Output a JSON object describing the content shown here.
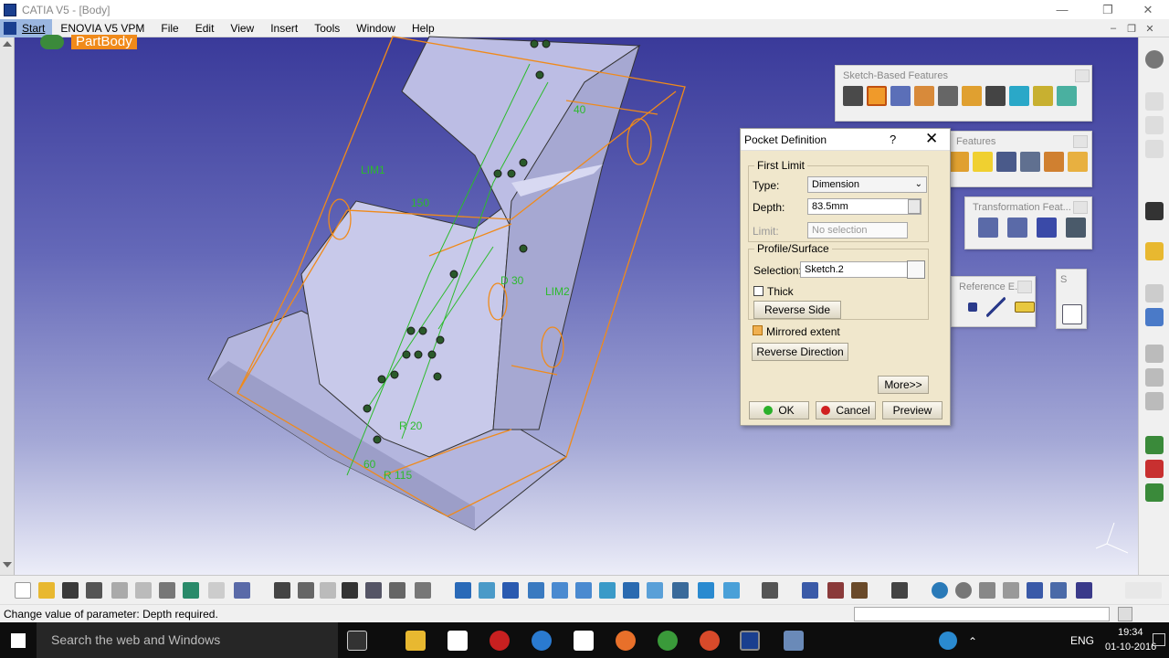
{
  "window": {
    "title": "CATIA V5 - [Body]"
  },
  "menu": {
    "items": [
      "Start",
      "ENOVIA V5 VPM",
      "File",
      "Edit",
      "View",
      "Insert",
      "Tools",
      "Window",
      "Help"
    ]
  },
  "tree": {
    "root": "PartBody"
  },
  "model": {
    "labels": [
      "LIM1",
      "LIM2",
      "150",
      "D 30",
      "40",
      "R 20",
      "R 115",
      "60"
    ]
  },
  "toolbars": {
    "sketch_based": {
      "title": "Sketch-Based Features"
    },
    "features2": {
      "title": "Features"
    },
    "transformation": {
      "title": "Transformation Feat..."
    },
    "reference": {
      "title": "Reference E..."
    },
    "sketcher": {
      "title": "S"
    }
  },
  "dialog": {
    "title": "Pocket Definition",
    "help": "?",
    "close": "✕",
    "first_limit": {
      "legend": "First Limit",
      "type_label": "Type:",
      "type_value": "Dimension",
      "depth_label": "Depth:",
      "depth_value": "83.5mm",
      "limit_label": "Limit:",
      "limit_value": "No selection"
    },
    "profile": {
      "legend": "Profile/Surface",
      "selection_label": "Selection:",
      "selection_value": "Sketch.2",
      "thick_label": "Thick",
      "thick_checked": false,
      "reverse_side": "Reverse Side"
    },
    "mirrored_label": "Mirrored extent",
    "mirrored_checked": true,
    "reverse_direction": "Reverse Direction",
    "more": "More>>",
    "ok": "OK",
    "cancel": "Cancel",
    "preview": "Preview"
  },
  "status": {
    "message": "Change value of parameter: Depth required."
  },
  "taskbar": {
    "search_placeholder": "Search the web and Windows",
    "lang": "ENG",
    "time": "19:34",
    "date": "01-10-2016"
  },
  "colors": {
    "orange": "#f08a1a",
    "green": "#2cbb2c",
    "dialog_bg": "#f0e7cc"
  }
}
